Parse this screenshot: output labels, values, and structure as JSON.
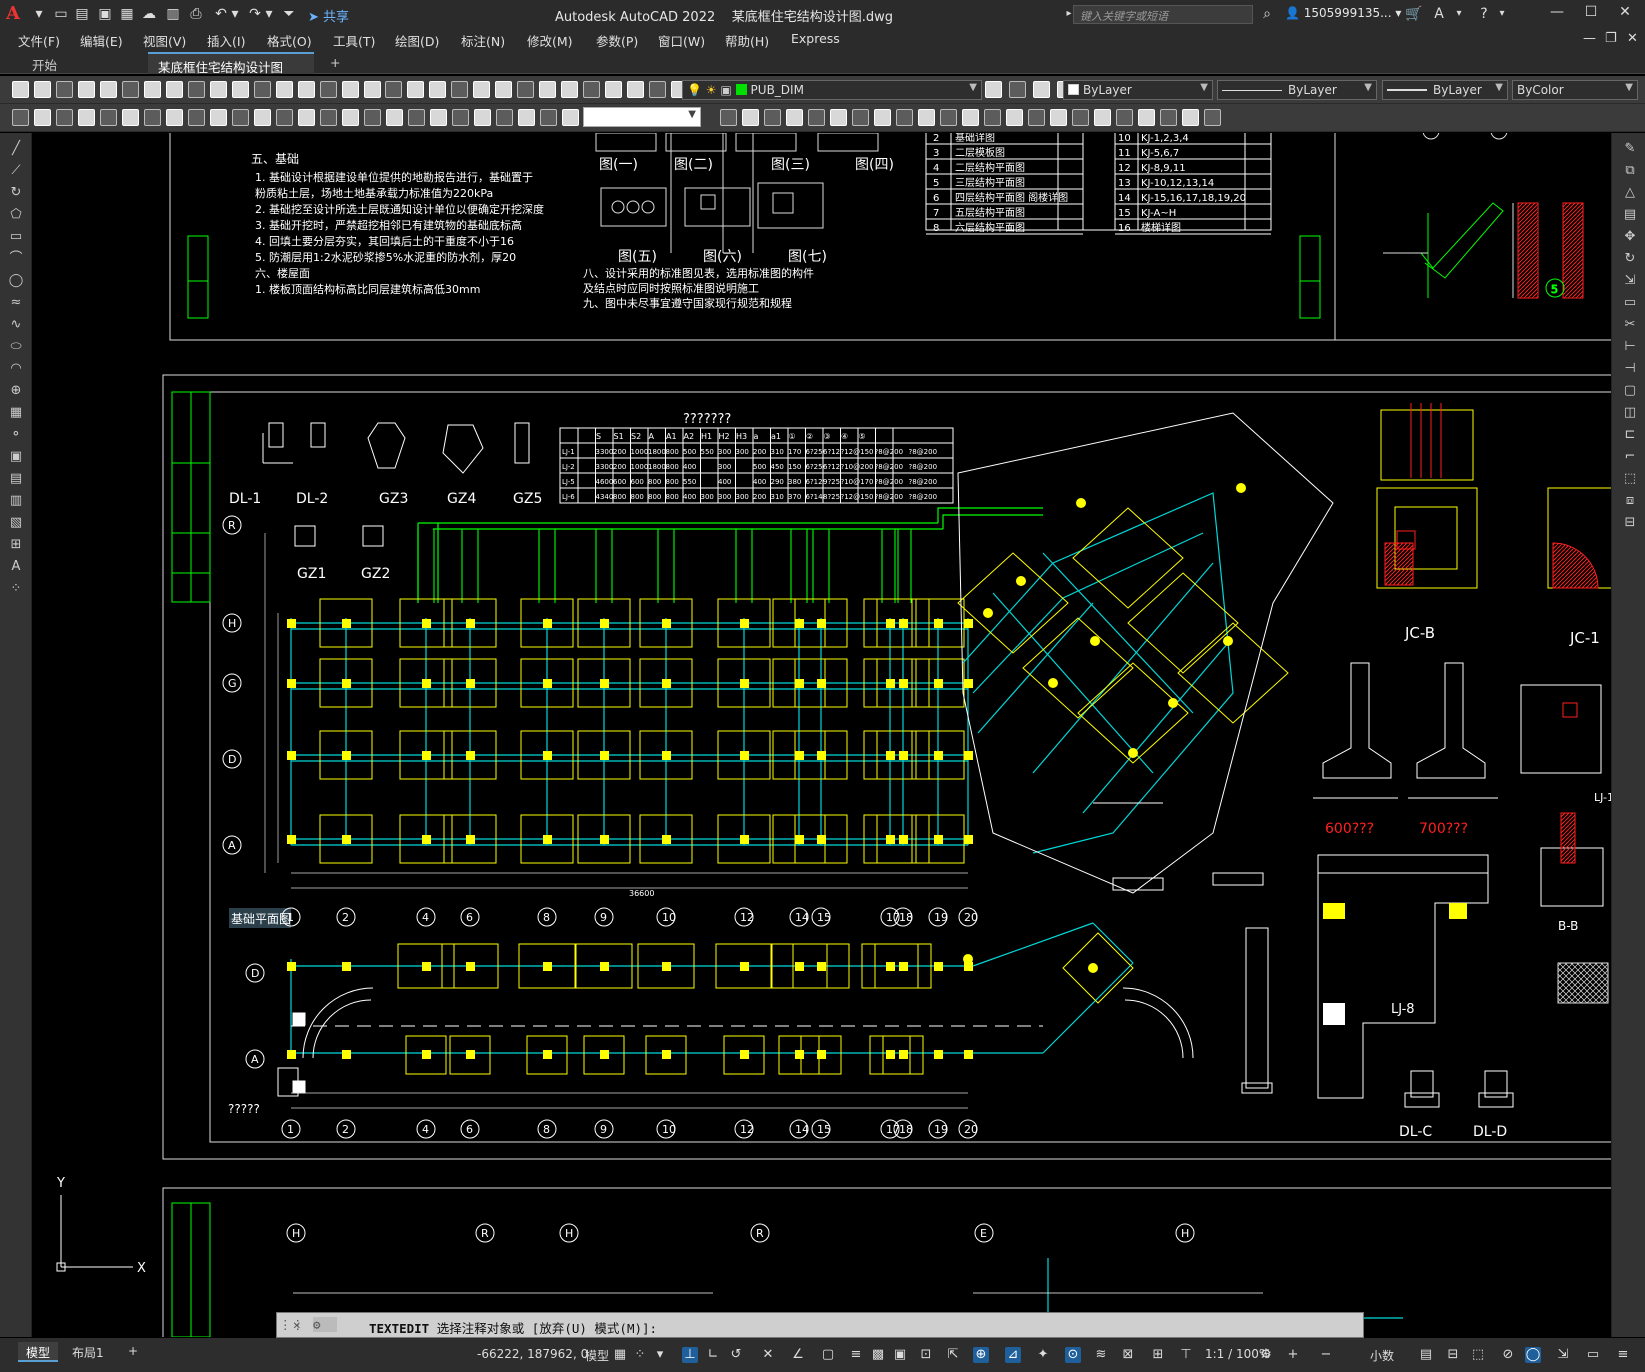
{
  "app": {
    "title": "Autodesk AutoCAD 2022",
    "document": "某底框住宅结构设计图.dwg",
    "logo": "A",
    "share_label": "共享",
    "search_placeholder": "键入关键字或短语",
    "user": "1505999135...",
    "accent": "#5a9fd4"
  },
  "menu": [
    "文件(F)",
    "编辑(E)",
    "视图(V)",
    "插入(I)",
    "格式(O)",
    "工具(T)",
    "绘图(D)",
    "标注(N)",
    "修改(M)",
    "参数(P)",
    "窗口(W)",
    "帮助(H)",
    "Express"
  ],
  "tabs": [
    {
      "label": "开始"
    },
    {
      "label": "某底框住宅结构设计图*"
    }
  ],
  "new_tab": "+",
  "toolbar": {
    "layer_name": "PUB_DIM",
    "color": "ByLayer",
    "linetype": "ByLayer",
    "lineweight": "ByLayer",
    "plotstyle": "ByColor"
  },
  "drawing": {
    "notes_title": "五、基础",
    "notes": [
      "1. 基础设计根据建设单位提供的地勘报告进行，基础置于",
      "   粉质粘土层，场地土地基承载力标准值为220kPa",
      "2. 基础挖至设计所选土层既通知设计单位以便确定开挖深度",
      "3. 基础开挖时，严禁超挖相邻已有建筑物的基础底标高",
      "4. 回填土要分层夯实，其回填后土的干重度不小于16",
      "5. 防潮层用1:2水泥砂浆掺5%水泥重的防水剂，厚20",
      "六、楼屋面",
      "1. 楼板顶面结构标高比同层建筑标高低30mm"
    ],
    "notes2": [
      "八、设计采用的标准图见表，选用标准图的构件",
      "   及结点时应同时按照标准图说明施工",
      "九、图中未尽事宜遵守国家现行规范和规程"
    ],
    "fig_labels": [
      "图(一)",
      "图(二)",
      "图(三)",
      "图(四)",
      "图(五)",
      "图(六)",
      "图(七)"
    ],
    "index_rows": [
      [
        "2",
        "基础详图"
      ],
      [
        "3",
        "二层模板图"
      ],
      [
        "4",
        "二层结构平面图"
      ],
      [
        "5",
        "三层结构平面图"
      ],
      [
        "6",
        "四层结构平面图 阁楼详图"
      ],
      [
        "7",
        "五层结构平面图"
      ],
      [
        "8",
        "六层结构平面图"
      ]
    ],
    "index_rows2": [
      [
        "10",
        "KJ-1,2,3,4"
      ],
      [
        "11",
        "KJ-5,6,7"
      ],
      [
        "12",
        "KJ-8,9,11"
      ],
      [
        "13",
        "KJ-10,12,13,14"
      ],
      [
        "14",
        "KJ-15,16,17,18,19,20"
      ],
      [
        "15",
        "KJ-A~H"
      ],
      [
        "16",
        "楼梯详图"
      ]
    ],
    "section_labels": [
      "DL-1",
      "DL-2",
      "GZ3",
      "GZ4",
      "GZ5",
      "GZ1",
      "GZ2"
    ],
    "table_title": "???????",
    "beam_table_head": [
      "S",
      "S1",
      "S2",
      "A",
      "A1",
      "A2",
      "H1",
      "H2",
      "H3",
      "a",
      "a1",
      "①",
      "②",
      "③",
      "④",
      "⑤"
    ],
    "beam_table_rows": [
      [
        "LJ-1",
        "3300",
        "200",
        "1000",
        "1800",
        "800",
        "500",
        "550",
        "300",
        "300",
        "200",
        "310",
        "170",
        "6?25",
        "6?12",
        "?12@150",
        "?8@200",
        "?8@200"
      ],
      [
        "LJ-2",
        "3300",
        "200",
        "1000",
        "1800",
        "800",
        "400",
        "",
        "300",
        "",
        "500",
        "450",
        "150",
        "6?25",
        "6?12",
        "?10@200",
        "?8@200",
        "?8@200"
      ],
      [
        "LJ-5",
        "4600",
        "600",
        "600",
        "800",
        "800",
        "550",
        "",
        "400",
        "",
        "400",
        "290",
        "380",
        "6?12",
        "9?25",
        "?10@170",
        "?8@200",
        "?8@200"
      ],
      [
        "LJ-6",
        "4340",
        "800",
        "800",
        "800",
        "800",
        "400",
        "300",
        "300",
        "300",
        "200",
        "310",
        "370",
        "6?14",
        "8?25",
        "?12@150",
        "?8@200",
        "?8@200"
      ]
    ],
    "plan_title": "基础平面图",
    "axis_bottom": [
      "1",
      "2",
      "4",
      "6",
      "8",
      "9",
      "10",
      "12",
      "14",
      "15",
      "17",
      "18",
      "19",
      "20"
    ],
    "axis_left": [
      "R",
      "H",
      "G",
      "D",
      "A"
    ],
    "axis_left2": [
      "D",
      "A"
    ],
    "axis_top3": [
      "H",
      "R",
      "H",
      "R",
      "E",
      "H"
    ],
    "dim_total": "36600",
    "red_labels": [
      "600???",
      "700???"
    ],
    "detail_labels": [
      "JC-B",
      "JC-1",
      "B-B",
      "LJ-8",
      "DL-C",
      "DL-D",
      "LJ-1"
    ],
    "pending": "?????"
  },
  "command": {
    "name": "TEXTEDIT",
    "prompt": "选择注释对象或",
    "options": "[放弃(U) 模式(M)]:"
  },
  "status": {
    "tabs": [
      "模型",
      "布局1"
    ],
    "add": "+",
    "coords": "-66222, 187962, 0",
    "space": "模型",
    "scale": "1:1 / 100%",
    "units": "小数"
  }
}
